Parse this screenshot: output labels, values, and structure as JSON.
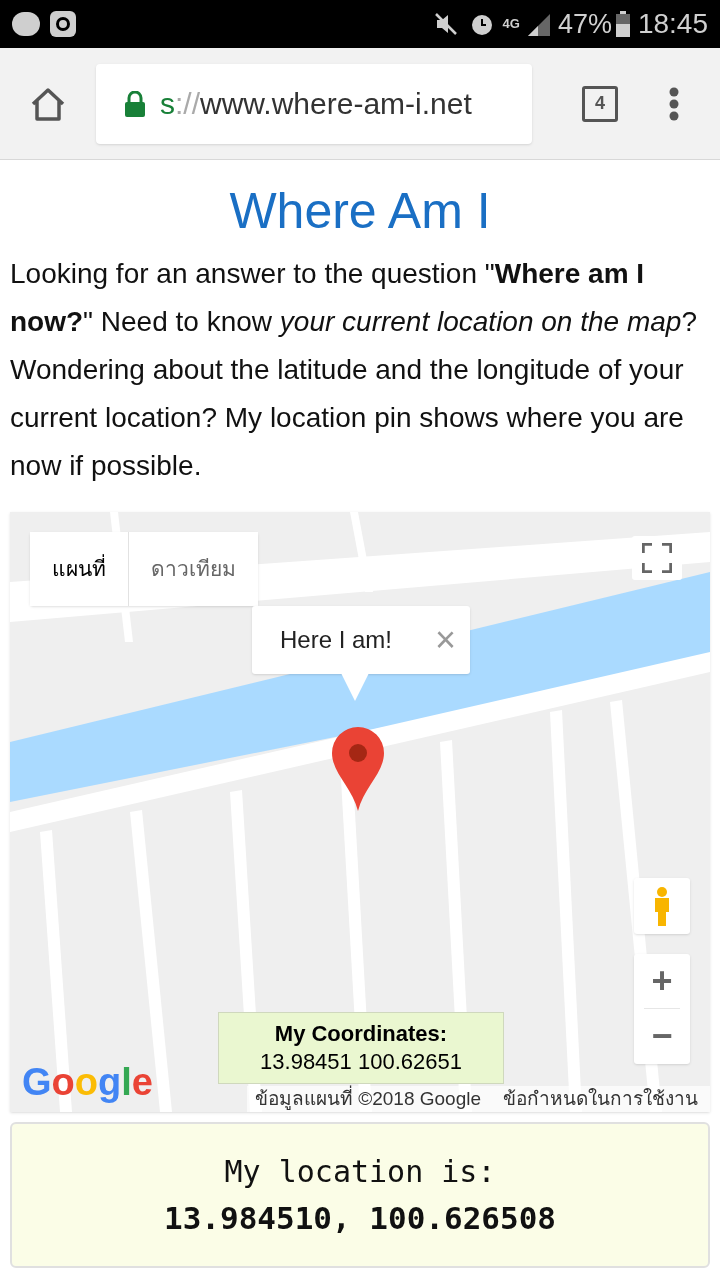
{
  "status_bar": {
    "network": "4G",
    "battery": "47%",
    "time": "18:45"
  },
  "browser": {
    "url_scheme": "s",
    "url_separator": "://",
    "url_host": "www.where-am-i.net",
    "tab_count": "4"
  },
  "page": {
    "title": "Where Am I",
    "intro": "Looking for an answer to the question \"**Where am I now?**\" Need to know *your current location on the map*? Wondering about the latitude and the longitude of your current location? My location pin shows where you are now if possible."
  },
  "map": {
    "map_types": [
      {
        "label": "แผนที่",
        "selected": true
      },
      {
        "label": "ดาวเทียม",
        "selected": false
      }
    ],
    "info_window": {
      "text": "Here I am!",
      "close": "×"
    },
    "zoom_in": "+",
    "zoom_out": "−",
    "coordinates": {
      "title": "My Coordinates:",
      "value": "13.98451 100.62651"
    },
    "logo": "Google",
    "attribution": "ข้อมูลแผนที่ ©2018 Google",
    "terms": "ข้อกำหนดในการใช้งาน"
  },
  "location": {
    "label": "My location is:",
    "value": "13.984510, 100.626508"
  }
}
